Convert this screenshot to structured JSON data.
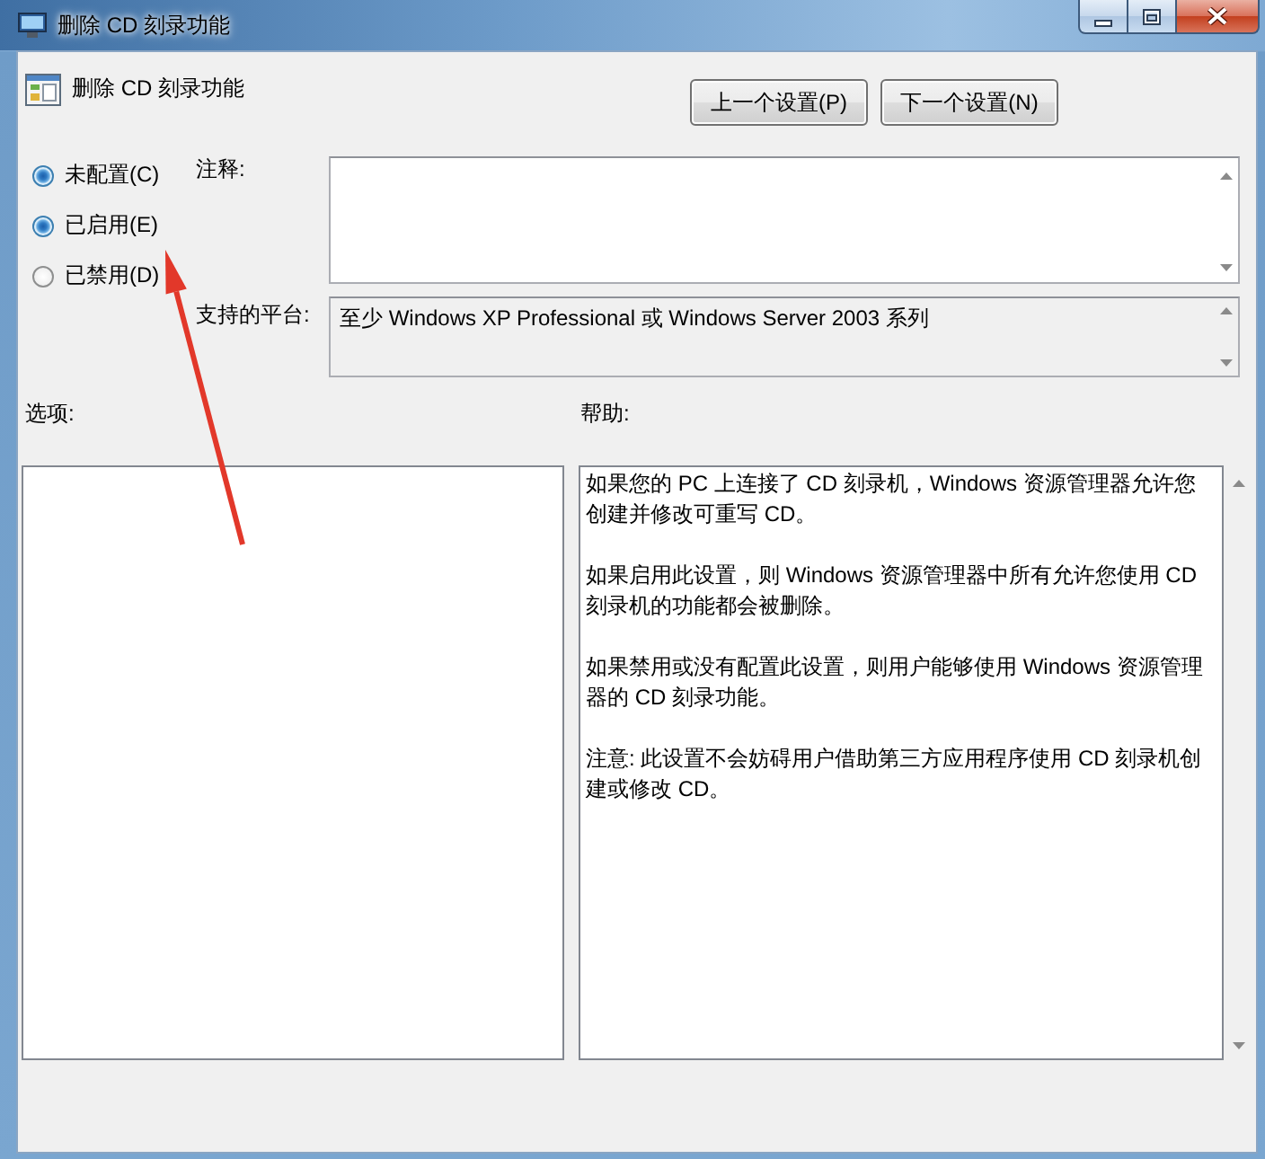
{
  "window": {
    "title": "删除 CD 刻录功能"
  },
  "header": {
    "title": "删除 CD 刻录功能",
    "buttons": [
      "上一个设置(P)",
      "下一个设置(N)"
    ]
  },
  "state_options": [
    {
      "label": "未配置(C)",
      "selected": true
    },
    {
      "label": "已启用(E)",
      "selected": true
    },
    {
      "label": "已禁用(D)",
      "selected": false
    }
  ],
  "comment": {
    "label": "注释:"
  },
  "platform": {
    "label": "支持的平台:",
    "value": "至少 Windows XP Professional 或 Windows Server 2003 系列"
  },
  "options": {
    "label": "选项:"
  },
  "help": {
    "label": "帮助:",
    "paragraphs": [
      "如果您的 PC 上连接了 CD 刻录机，Windows 资源管理器允许您创建并修改可重写 CD。",
      "如果启用此设置，则 Windows 资源管理器中所有允许您使用 CD 刻录机的功能都会被删除。",
      "如果禁用或没有配置此设置，则用户能够使用 Windows 资源管理器的 CD 刻录功能。",
      "注意: 此设置不会妨碍用户借助第三方应用程序使用 CD 刻录机创建或修改 CD。"
    ]
  },
  "annotations": [
    {
      "kind": "arrow"
    }
  ]
}
